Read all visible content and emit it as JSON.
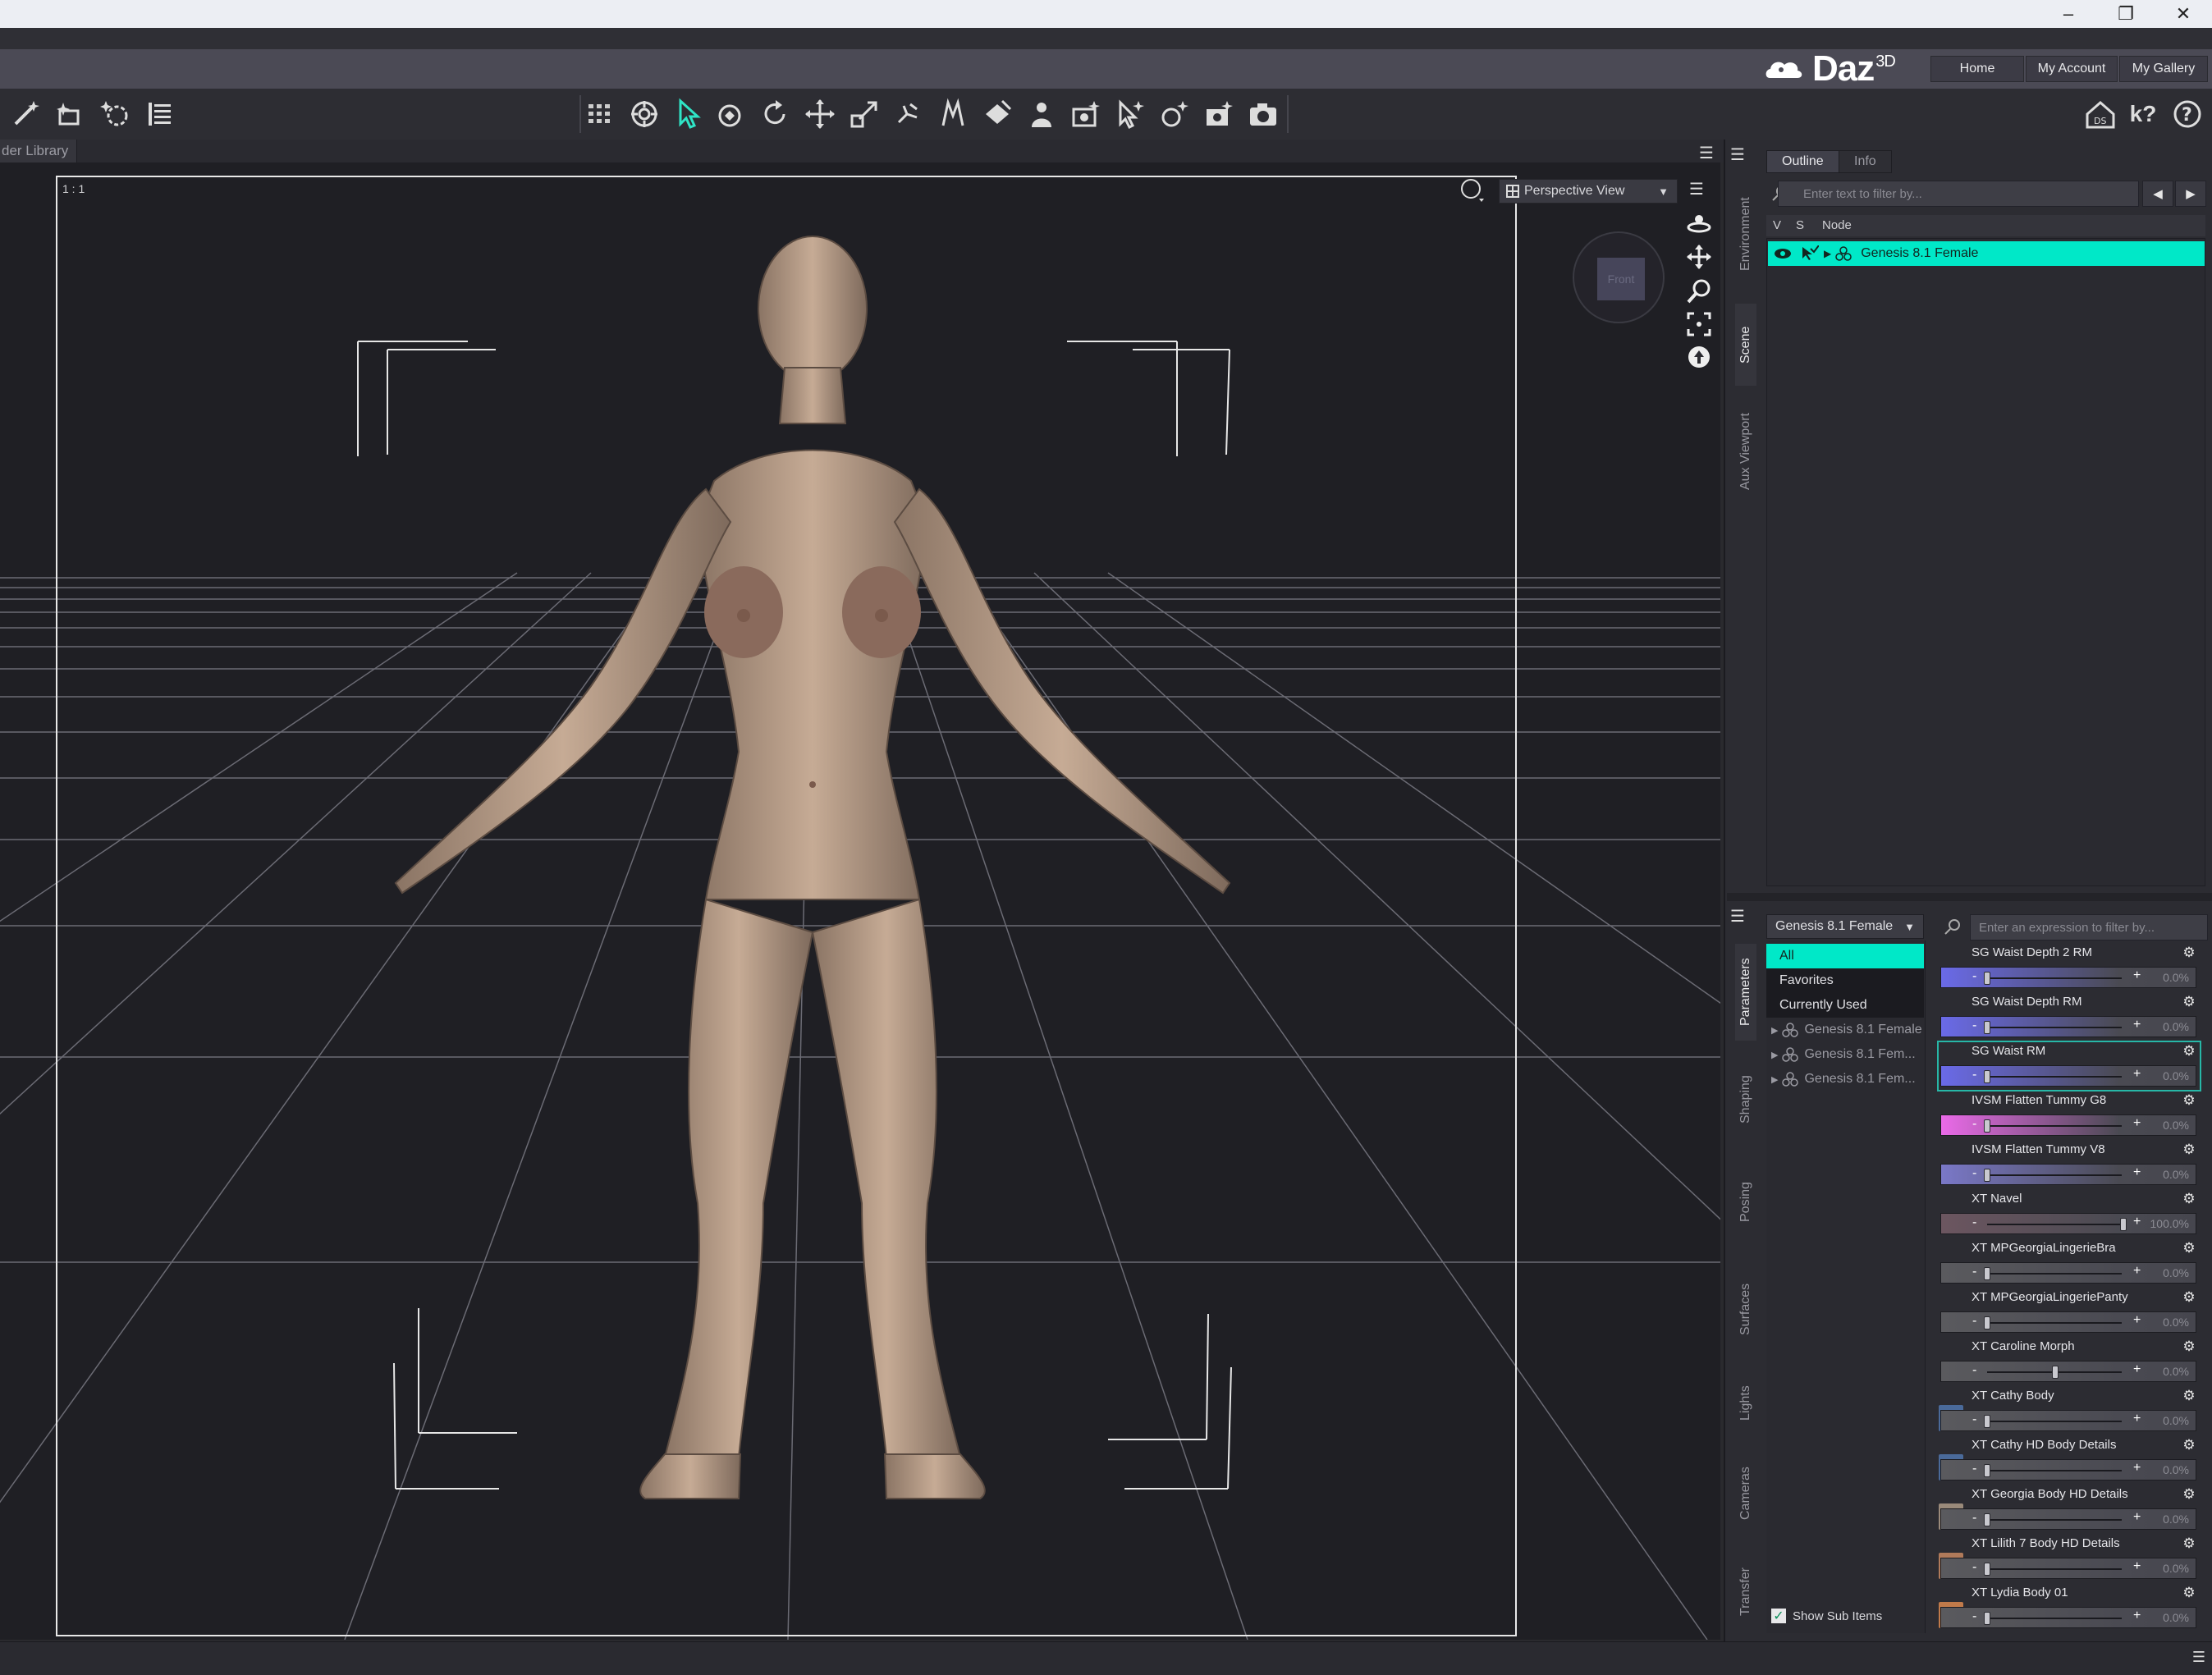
{
  "window": {
    "minimize": "–",
    "restore": "❐",
    "close": "✕"
  },
  "header": {
    "brand": "Daz",
    "brand_sup": "3D",
    "nav": [
      "Home",
      "My Account",
      "My Gallery"
    ],
    "help_link": "k?",
    "help_icon": "?"
  },
  "library_tab": {
    "label": "der Library"
  },
  "viewport": {
    "label": "1 : 1",
    "view_select": "Perspective View",
    "cube_face": "Front"
  },
  "scene": {
    "tabs": [
      "Outline",
      "Info"
    ],
    "filter_placeholder": "Enter text to filter by...",
    "columns": {
      "v": "V",
      "s": "S",
      "node": "Node"
    },
    "node": "Genesis 8.1 Female"
  },
  "side_tabs_top": [
    "Environment",
    "Scene",
    "Aux Viewport"
  ],
  "side_tabs_bottom": [
    "Parameters",
    "Shaping",
    "Posing",
    "Surfaces",
    "Lights",
    "Cameras",
    "Transfer"
  ],
  "parameters": {
    "figure_select": "Genesis 8.1 Female",
    "categories": [
      {
        "label": "All",
        "style": "active"
      },
      {
        "label": "Favorites",
        "style": "plain"
      },
      {
        "label": "Currently Used",
        "style": "plain"
      },
      {
        "label": "Genesis 8.1 Female",
        "style": "tree"
      },
      {
        "label": "Genesis 8.1 Fem...",
        "style": "tree"
      },
      {
        "label": "Genesis 8.1 Fem...",
        "style": "tree"
      }
    ],
    "filter_placeholder": "Enter an expression to filter by...",
    "show_sub_items": "Show Sub Items",
    "check_mark": "✓",
    "items": [
      {
        "name": "SG Waist Depth 2 RM",
        "value": "0.0%",
        "pos": 0.0,
        "color": "#6a6ae8",
        "thumb": ""
      },
      {
        "name": "SG Waist Depth RM",
        "value": "0.0%",
        "pos": 0.0,
        "color": "#6a6ae8",
        "thumb": ""
      },
      {
        "name": "SG Waist RM",
        "value": "0.0%",
        "pos": 0.0,
        "color": "#6a6ae8",
        "thumb": ""
      },
      {
        "name": "IVSM Flatten Tummy G8",
        "value": "0.0%",
        "pos": 0.0,
        "color": "#ea6ae8",
        "thumb": ""
      },
      {
        "name": "IVSM Flatten Tummy V8",
        "value": "0.0%",
        "pos": 0.0,
        "color": "#7a78c8",
        "thumb": ""
      },
      {
        "name": "XT Navel",
        "value": "100.0%",
        "pos": 1.0,
        "color": "#6c5660",
        "thumb": ""
      },
      {
        "name": "XT MPGeorgiaLingerieBra",
        "value": "0.0%",
        "pos": 0.0,
        "color": "#5a5a5e",
        "thumb": ""
      },
      {
        "name": "XT MPGeorgiaLingeriePanty",
        "value": "0.0%",
        "pos": 0.0,
        "color": "#5a5a5e",
        "thumb": ""
      },
      {
        "name": "XT Caroline Morph",
        "value": "0.0%",
        "pos": 0.5,
        "color": "#5a5a5e",
        "thumb": ""
      },
      {
        "name": "XT Cathy Body",
        "value": "0.0%",
        "pos": 0.0,
        "color": "#5a5a5e",
        "thumb": "#4a6a9a"
      },
      {
        "name": "XT Cathy HD Body Details",
        "value": "0.0%",
        "pos": 0.0,
        "color": "#5a5a5e",
        "thumb": "#4a6a9a"
      },
      {
        "name": "XT Georgia Body HD Details",
        "value": "0.0%",
        "pos": 0.0,
        "color": "#5a5a5e",
        "thumb": "#9a8a7a"
      },
      {
        "name": "XT Lilith 7 Body HD Details",
        "value": "0.0%",
        "pos": 0.0,
        "color": "#5a5a5e",
        "thumb": "#b07a5a"
      },
      {
        "name": "XT Lydia Body 01",
        "value": "0.0%",
        "pos": 0.0,
        "color": "#5a5a5e",
        "thumb": "#c07a4a"
      }
    ]
  }
}
